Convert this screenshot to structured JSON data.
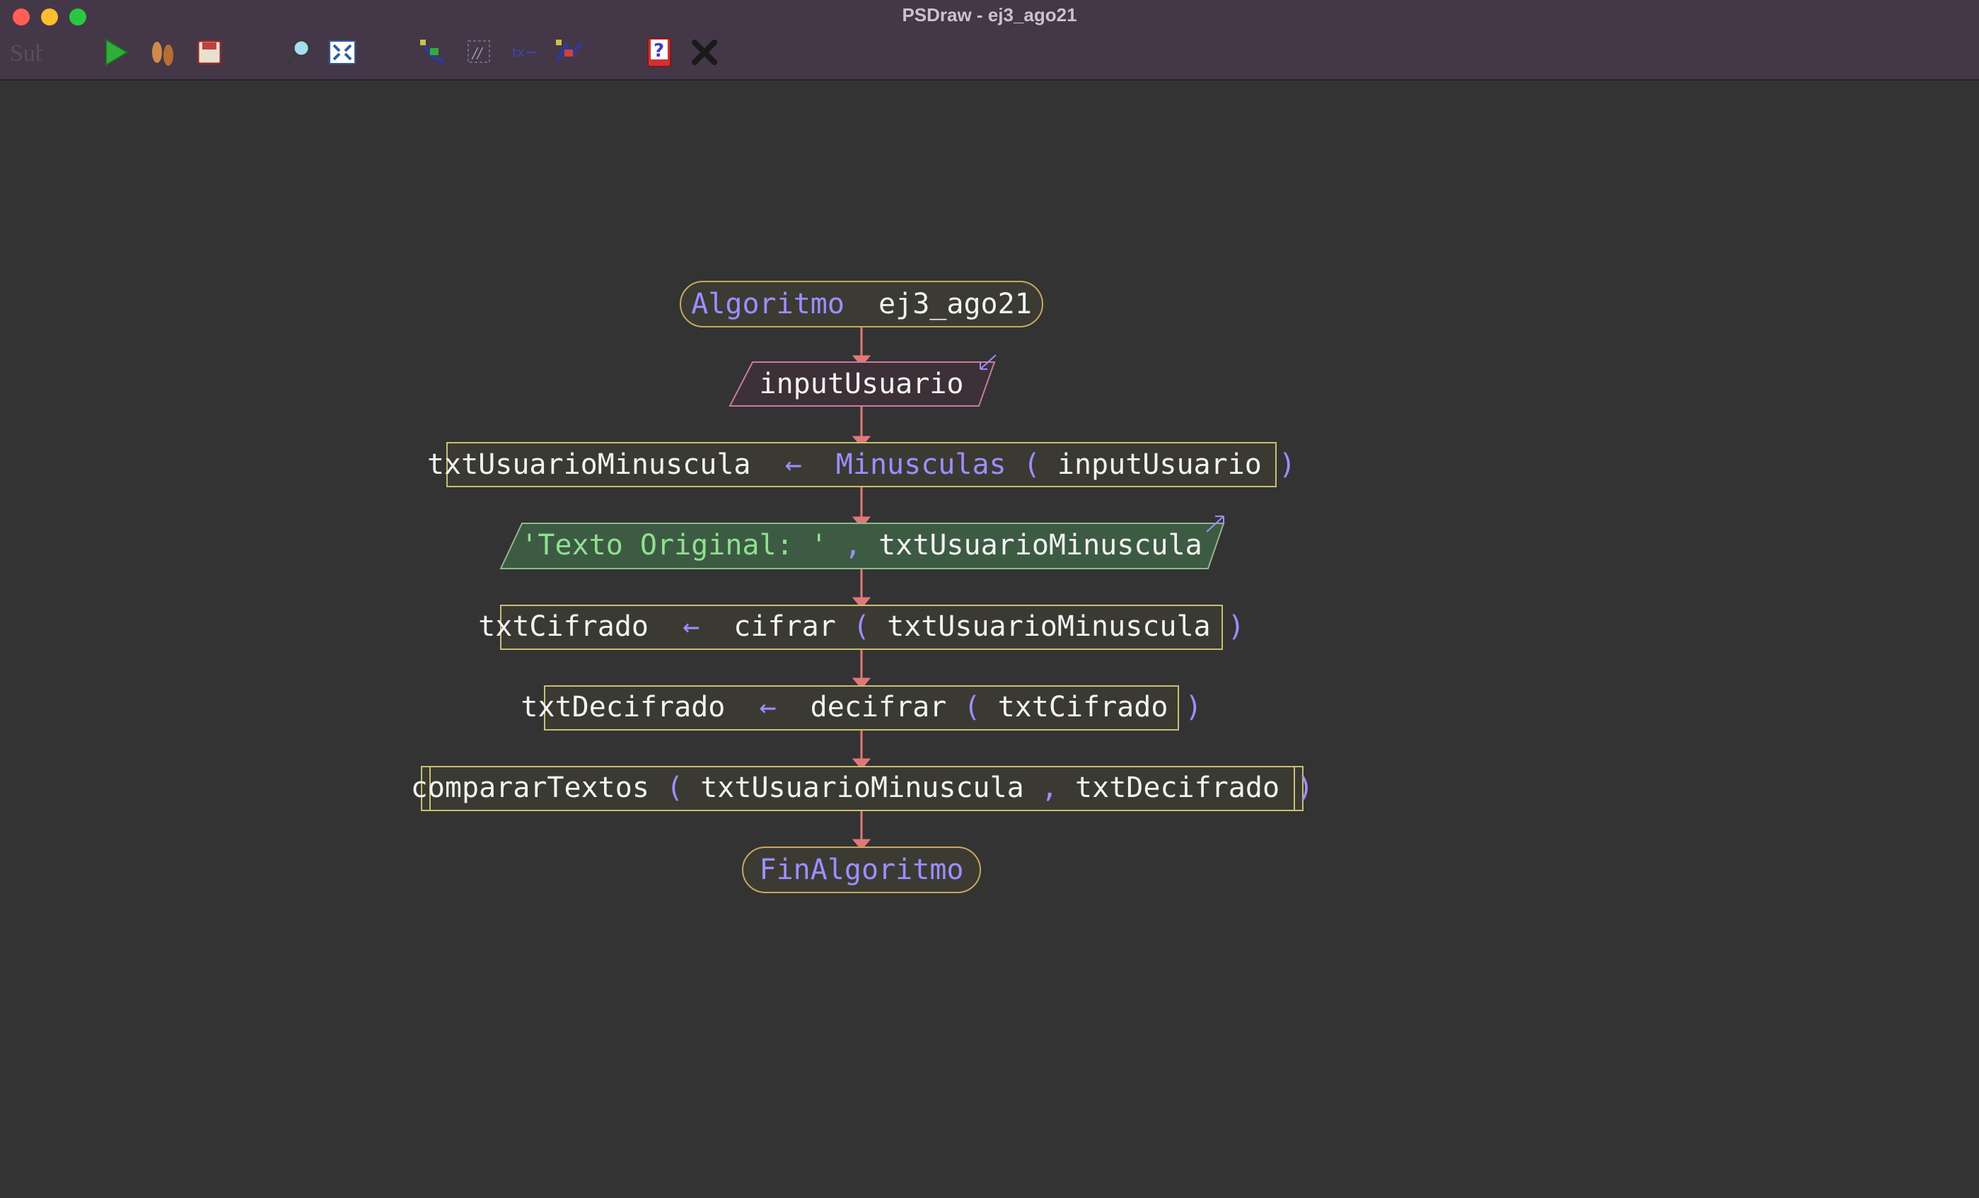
{
  "window": {
    "title": "PSDraw - ej3_ago21"
  },
  "toolbar": {
    "items": [
      {
        "icon": "subprocess-icon",
        "label": "Sub"
      },
      {
        "icon": "run-icon"
      },
      {
        "icon": "step-icon"
      },
      {
        "icon": "save-icon"
      },
      {
        "icon": "zoom-icon"
      },
      {
        "icon": "fit-icon"
      },
      {
        "icon": "style-icon"
      },
      {
        "icon": "comments-icon",
        "label": "//"
      },
      {
        "icon": "text-size-icon",
        "label": "tx"
      },
      {
        "icon": "layout-icon"
      },
      {
        "icon": "help-icon",
        "label": "?"
      },
      {
        "icon": "close-icon"
      }
    ]
  },
  "colors": {
    "background": "#333333",
    "titlebar": "#433748",
    "connector": "#e07878",
    "process_border": "#c8c070",
    "keyword": "#9f8cff",
    "string": "#8fe08f",
    "text": "#f2f2f2",
    "output_fill": "#3d5a42",
    "input_border": "#c87aa0"
  },
  "flowchart": {
    "start": {
      "keyword": "Algoritmo",
      "name": "ej3_ago21"
    },
    "read": {
      "var": "inputUsuario"
    },
    "assign1": {
      "target": "txtUsuarioMinuscula",
      "arrow": "←",
      "func": "Minusculas",
      "open": "(",
      "arg": "inputUsuario",
      "close": ")"
    },
    "write": {
      "string": "'Texto Original: '",
      "comma": ",",
      "var": "txtUsuarioMinuscula"
    },
    "assign2": {
      "target": "txtCifrado",
      "arrow": "←",
      "func": "cifrar",
      "open": "(",
      "arg": "txtUsuarioMinuscula",
      "close": ")"
    },
    "assign3": {
      "target": "txtDecifrado",
      "arrow": "←",
      "func": "decifrar",
      "open": "(",
      "arg": "txtCifrado",
      "close": ")"
    },
    "call": {
      "func": "compararTextos",
      "open": "(",
      "arg1": "txtUsuarioMinuscula",
      "comma": ",",
      "arg2": "txtDecifrado",
      "close": ")"
    },
    "end": {
      "keyword": "FinAlgoritmo"
    }
  }
}
